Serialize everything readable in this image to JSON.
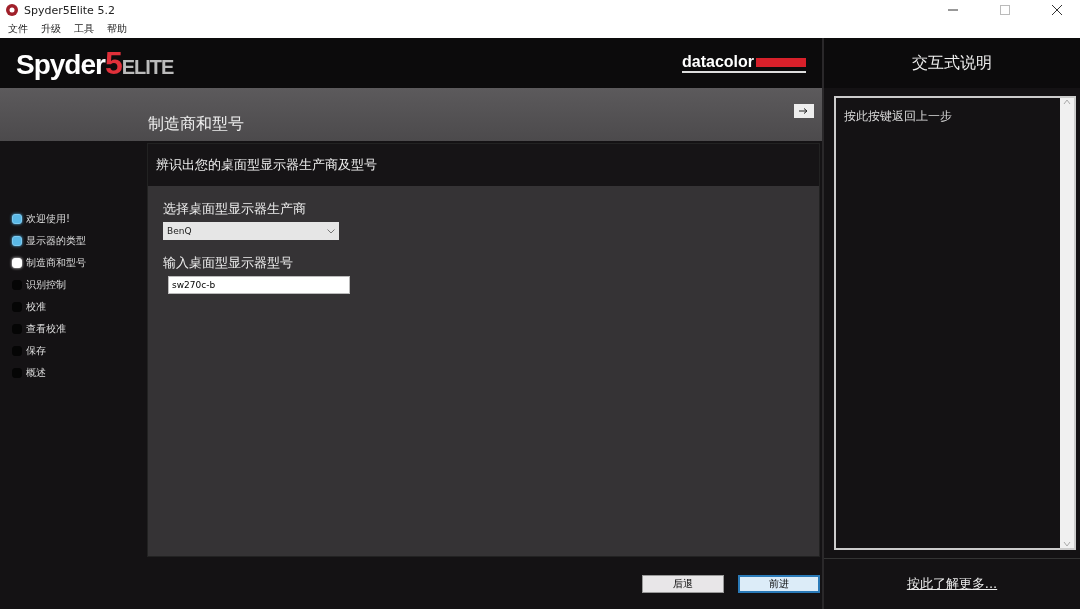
{
  "window": {
    "title": "Spyder5Elite 5.2",
    "maximize_disabled": true
  },
  "menu": [
    "文件",
    "升级",
    "工具",
    "帮助"
  ],
  "logo": {
    "name": "Spyder",
    "number": "5",
    "edition": "ELITE"
  },
  "brand": "datacolor",
  "page_title": "制造商和型号",
  "steps": [
    {
      "label": "欢迎使用!",
      "completed": true,
      "selected": false
    },
    {
      "label": "显示器的类型",
      "completed": true,
      "selected": false
    },
    {
      "label": "制造商和型号",
      "completed": false,
      "selected": true
    },
    {
      "label": "识别控制",
      "completed": false,
      "selected": false
    },
    {
      "label": "校准",
      "completed": false,
      "selected": false
    },
    {
      "label": "查看校准",
      "completed": false,
      "selected": false
    },
    {
      "label": "保存",
      "completed": false,
      "selected": false
    },
    {
      "label": "概述",
      "completed": false,
      "selected": false
    }
  ],
  "panel": {
    "heading": "辨识出您的桌面型显示器生产商及型号",
    "manufacturer_label": "选择桌面型显示器生产商",
    "manufacturer": "BenQ",
    "model_label": "输入桌面型显示器型号",
    "model": "sw270c-b"
  },
  "buttons": [
    {
      "label": "后退",
      "focused": false
    },
    {
      "label": "前进",
      "focused": true
    }
  ],
  "help": {
    "title": "交互式说明",
    "text": "按此按键返回上一步",
    "link": "按此了解更多..."
  }
}
